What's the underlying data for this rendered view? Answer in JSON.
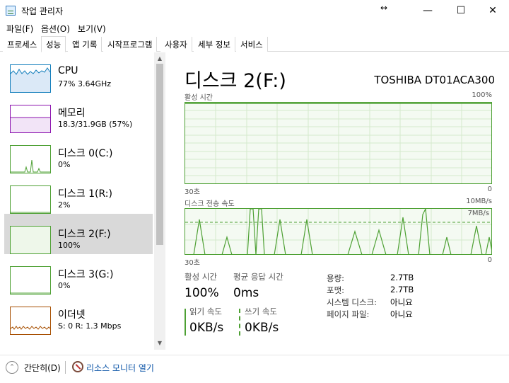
{
  "window": {
    "title": "작업 관리자",
    "resize_glyph": "↔",
    "minimize_glyph": "—",
    "maximize_glyph": "☐",
    "close_glyph": "✕"
  },
  "menu": [
    {
      "label": "파일(F)"
    },
    {
      "label": "옵션(O)"
    },
    {
      "label": "보기(V)"
    }
  ],
  "tabs": [
    {
      "label": "프로세스"
    },
    {
      "label": "성능",
      "active": true
    },
    {
      "label": "앱 기록"
    },
    {
      "label": "시작프로그램"
    },
    {
      "label": "사용자"
    },
    {
      "label": "세부 정보"
    },
    {
      "label": "서비스"
    }
  ],
  "sidebar": {
    "items": [
      {
        "name": "CPU",
        "value": "77% 3.64GHz",
        "color": "#117dbb"
      },
      {
        "name": "메모리",
        "value": "18.3/31.9GB (57%)",
        "color": "#8b12ae"
      },
      {
        "name": "디스크 0(C:)",
        "value": "0%",
        "color": "#4da033"
      },
      {
        "name": "디스크 1(R:)",
        "value": "2%",
        "color": "#4da033"
      },
      {
        "name": "디스크 2(F:)",
        "value": "100%",
        "color": "#4da033",
        "selected": true
      },
      {
        "name": "디스크 3(G:)",
        "value": "0%",
        "color": "#4da033"
      },
      {
        "name": "이더넷",
        "value": "S: 0 R: 1.3 Mbps",
        "color": "#a74f01"
      }
    ]
  },
  "scroll": {
    "up_glyph": "▲",
    "down_glyph": "▼"
  },
  "main": {
    "title": "디스크 2(F:)",
    "model": "TOSHIBA DT01ACA300",
    "graph1": {
      "label": "활성 시간",
      "max": "100%",
      "time": "30초",
      "min": "0"
    },
    "graph2": {
      "label": "디스크 전송 속도",
      "max": "10MB/s",
      "sub_max": "7MB/s",
      "time": "30초",
      "min": "0"
    }
  },
  "stats": {
    "active_label": "활성 시간",
    "active_value": "100%",
    "response_label": "평균 응답 시간",
    "response_value": "0ms",
    "read_label": "읽기 속도",
    "read_value": "0KB/s",
    "write_label": "쓰기 속도",
    "write_value": "0KB/s"
  },
  "info": [
    {
      "label": "용량:",
      "value": "2.7TB"
    },
    {
      "label": "포맷:",
      "value": "2.7TB"
    },
    {
      "label": "시스템 디스크:",
      "value": "아니요"
    },
    {
      "label": "페이지 파일:",
      "value": "아니요"
    }
  ],
  "footer": {
    "collapse_label": "간단히(D)",
    "collapse_glyph": "⌃",
    "monitor_label": "리소스 모니터 열기"
  }
}
